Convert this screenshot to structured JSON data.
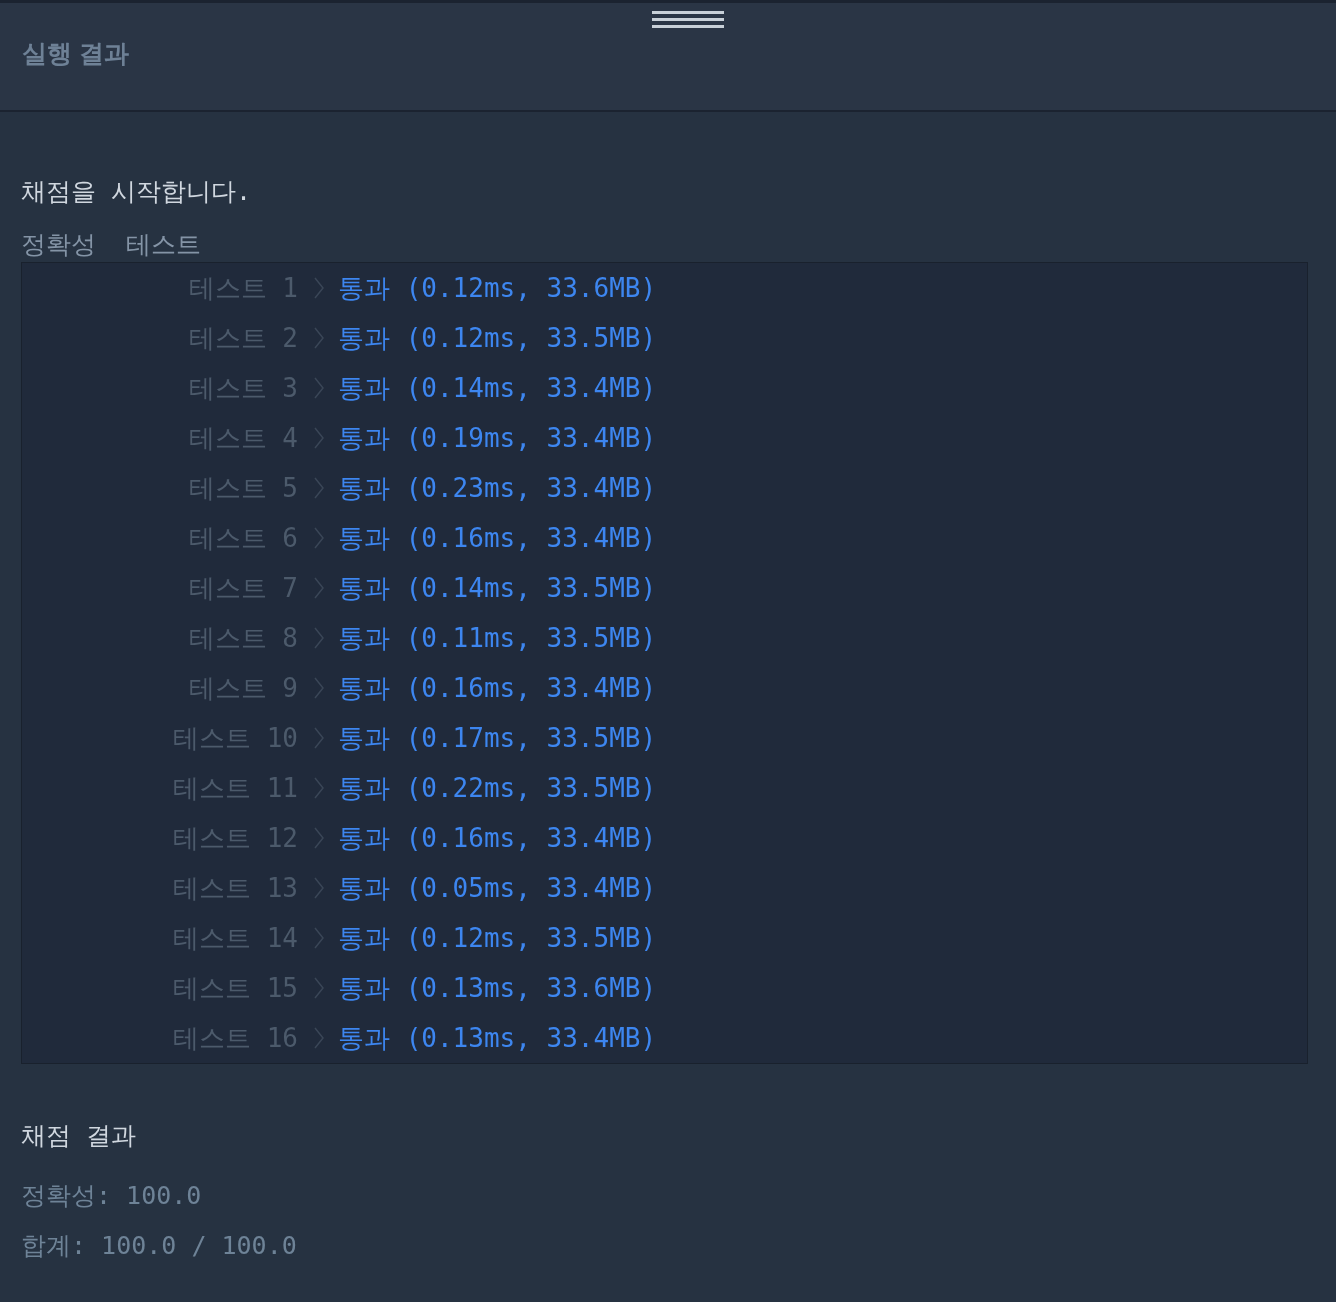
{
  "header": {
    "title": "실행 결과"
  },
  "output": {
    "intro": "채점을 시작합니다.",
    "section": "정확성  테스트",
    "tests": [
      {
        "label": "테스트 1",
        "result": "통과 (0.12ms, 33.6MB)"
      },
      {
        "label": "테스트 2",
        "result": "통과 (0.12ms, 33.5MB)"
      },
      {
        "label": "테스트 3",
        "result": "통과 (0.14ms, 33.4MB)"
      },
      {
        "label": "테스트 4",
        "result": "통과 (0.19ms, 33.4MB)"
      },
      {
        "label": "테스트 5",
        "result": "통과 (0.23ms, 33.4MB)"
      },
      {
        "label": "테스트 6",
        "result": "통과 (0.16ms, 33.4MB)"
      },
      {
        "label": "테스트 7",
        "result": "통과 (0.14ms, 33.5MB)"
      },
      {
        "label": "테스트 8",
        "result": "통과 (0.11ms, 33.5MB)"
      },
      {
        "label": "테스트 9",
        "result": "통과 (0.16ms, 33.4MB)"
      },
      {
        "label": "테스트 10",
        "result": "통과 (0.17ms, 33.5MB)"
      },
      {
        "label": "테스트 11",
        "result": "통과 (0.22ms, 33.5MB)"
      },
      {
        "label": "테스트 12",
        "result": "통과 (0.16ms, 33.4MB)"
      },
      {
        "label": "테스트 13",
        "result": "통과 (0.05ms, 33.4MB)"
      },
      {
        "label": "테스트 14",
        "result": "통과 (0.12ms, 33.5MB)"
      },
      {
        "label": "테스트 15",
        "result": "통과 (0.13ms, 33.6MB)"
      },
      {
        "label": "테스트 16",
        "result": "통과 (0.13ms, 33.4MB)"
      }
    ],
    "summary_title": "채점 결과",
    "summary_lines": [
      "정확성: 100.0",
      "합계: 100.0 / 100.0"
    ]
  }
}
